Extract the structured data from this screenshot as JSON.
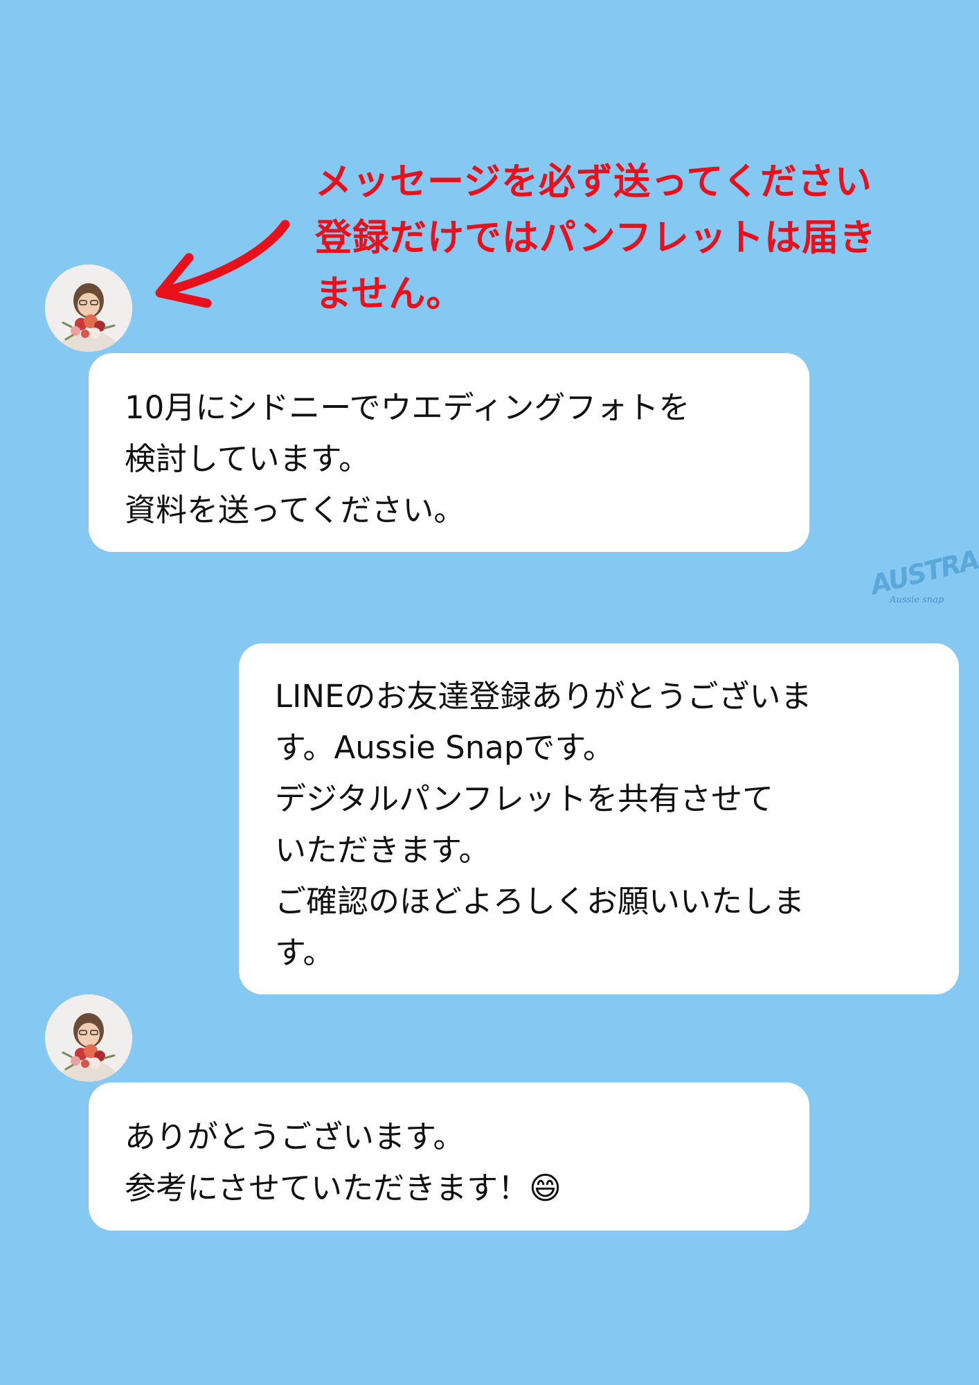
{
  "notice": {
    "lines": [
      "メッセージを必ず送ってください",
      "登録だけではパンフレットは届き",
      "ません。"
    ]
  },
  "messages": [
    {
      "sender": "user",
      "lines": [
        "10月にシドニーでウエディングフォトを",
        "検討しています。",
        "資料を送ってください。"
      ]
    },
    {
      "sender": "shop",
      "lines": [
        "LINEのお友達登録ありがとうございま",
        "す。Aussie Snapです。",
        "デジタルパンフレットを共有させて",
        "いただきます。",
        "ご確認のほどよろしくお願いいたしま",
        "す。"
      ]
    },
    {
      "sender": "user",
      "lines": [
        "ありがとうございます。",
        "参考にさせていただきます！😄"
      ]
    }
  ],
  "logo": {
    "word": "AUSTRALIA",
    "script": "Aussie snap"
  },
  "icons": {
    "arrow": "arrow-icon",
    "avatar": "avatar-photo"
  },
  "colors": {
    "background": "#85c8f2",
    "notice_text": "#e8101a",
    "bubble": "#ffffff",
    "logo": "#5aa7d9"
  }
}
